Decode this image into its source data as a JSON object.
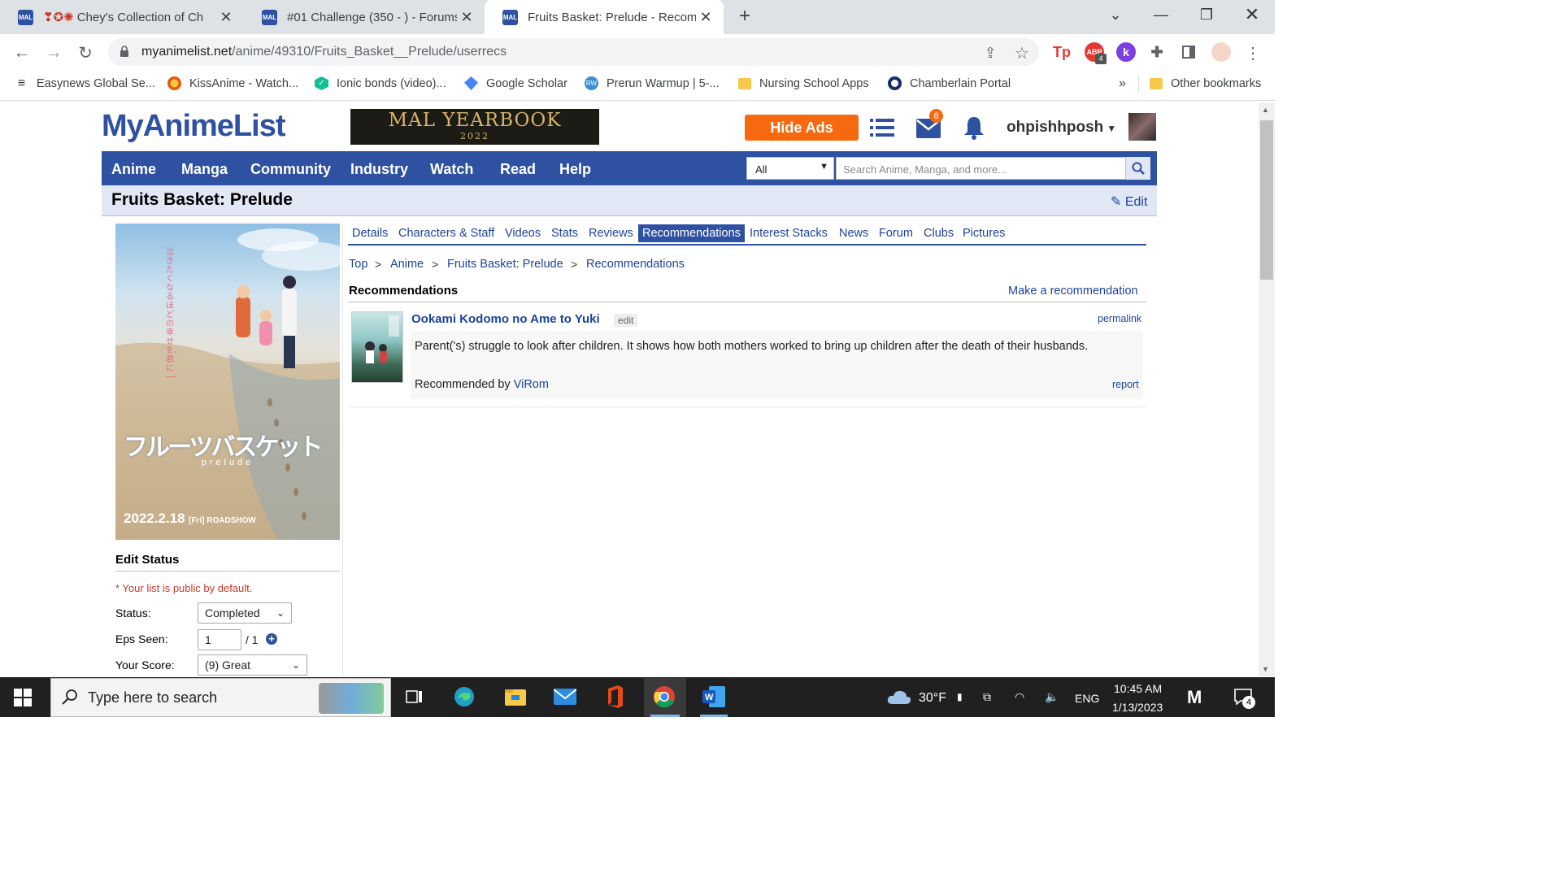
{
  "browser": {
    "tabs": [
      {
        "title": "Chey's Collection of Ch",
        "prefix": "❣✪✺"
      },
      {
        "title": "#01 Challenge (350 - ) - Forums"
      },
      {
        "title": "Fruits Basket: Prelude - Recomme"
      }
    ],
    "tab_favicon_text": "MAL",
    "url_host": "myanimelist.net",
    "url_path": "/anime/49310/Fruits_Basket__Prelude/userrecs",
    "extension_badge": "4",
    "bookmarks": [
      "Easynews Global Se...",
      "KissAnime - Watch...",
      "Ionic bonds (video)...",
      "Google Scholar",
      "Prerun Warmup | 5-...",
      "Nursing School Apps",
      "Chamberlain Portal"
    ],
    "bookmarks_overflow": "»",
    "other_bookmarks": "Other bookmarks"
  },
  "site": {
    "logo": "MyAnimeList",
    "yearbook_title": "MAL YEARBOOK",
    "yearbook_year": "2022",
    "hide_ads": "Hide Ads",
    "mail_badge": "8",
    "username": "ohpishhposh",
    "nav": [
      "Anime",
      "Manga",
      "Community",
      "Industry",
      "Watch",
      "Read",
      "Help"
    ],
    "search_category": "All",
    "search_placeholder": "Search Anime, Manga, and more..."
  },
  "page": {
    "title": "Fruits Basket: Prelude",
    "edit": "Edit",
    "subnav": [
      "Details",
      "Characters & Staff",
      "Videos",
      "Stats",
      "Reviews",
      "Recommendations",
      "Interest Stacks",
      "News",
      "Forum",
      "Clubs",
      "Pictures"
    ],
    "subnav_active": "Recommendations",
    "breadcrumb": [
      "Top",
      "Anime",
      "Fruits Basket: Prelude",
      "Recommendations"
    ],
    "breadcrumb_sep": ">",
    "section_title": "Recommendations",
    "make_recommendation": "Make a recommendation"
  },
  "recommendation": {
    "title": "Ookami Kodomo no Ame to Yuki",
    "edit": "edit",
    "permalink": "permalink",
    "text": "Parent('s) struggle to look after children. It shows how both mothers worked to bring up children after the death of their husbands.",
    "recommended_by_label": "Recommended by",
    "recommended_by_user": "ViRom",
    "report": "report"
  },
  "poster": {
    "title_jp": "フルーツバスケット",
    "subtitle": "prelude",
    "date": "2022.2.18",
    "date_suffix": "[Fri] ROADSHOW",
    "tagline_jp": "泣きたくなるほどの幸せを、君に ──"
  },
  "edit_status": {
    "heading": "Edit Status",
    "note": "* Your list is public by default.",
    "status_label": "Status:",
    "status_value": "Completed",
    "eps_label": "Eps Seen:",
    "eps_value": "1",
    "eps_total": "/ 1",
    "score_label": "Your Score:",
    "score_value": "(9) Great"
  },
  "taskbar": {
    "search_placeholder": "Type here to search",
    "weather": "30°F",
    "language": "ENG",
    "time": "10:45 AM",
    "date": "1/13/2023",
    "notification_count": "4"
  },
  "colors": {
    "mal_blue": "#2e51a2",
    "link_blue": "#1c439b",
    "hide_ads_orange": "#f7690f",
    "title_bar": "#e1e7f5"
  }
}
